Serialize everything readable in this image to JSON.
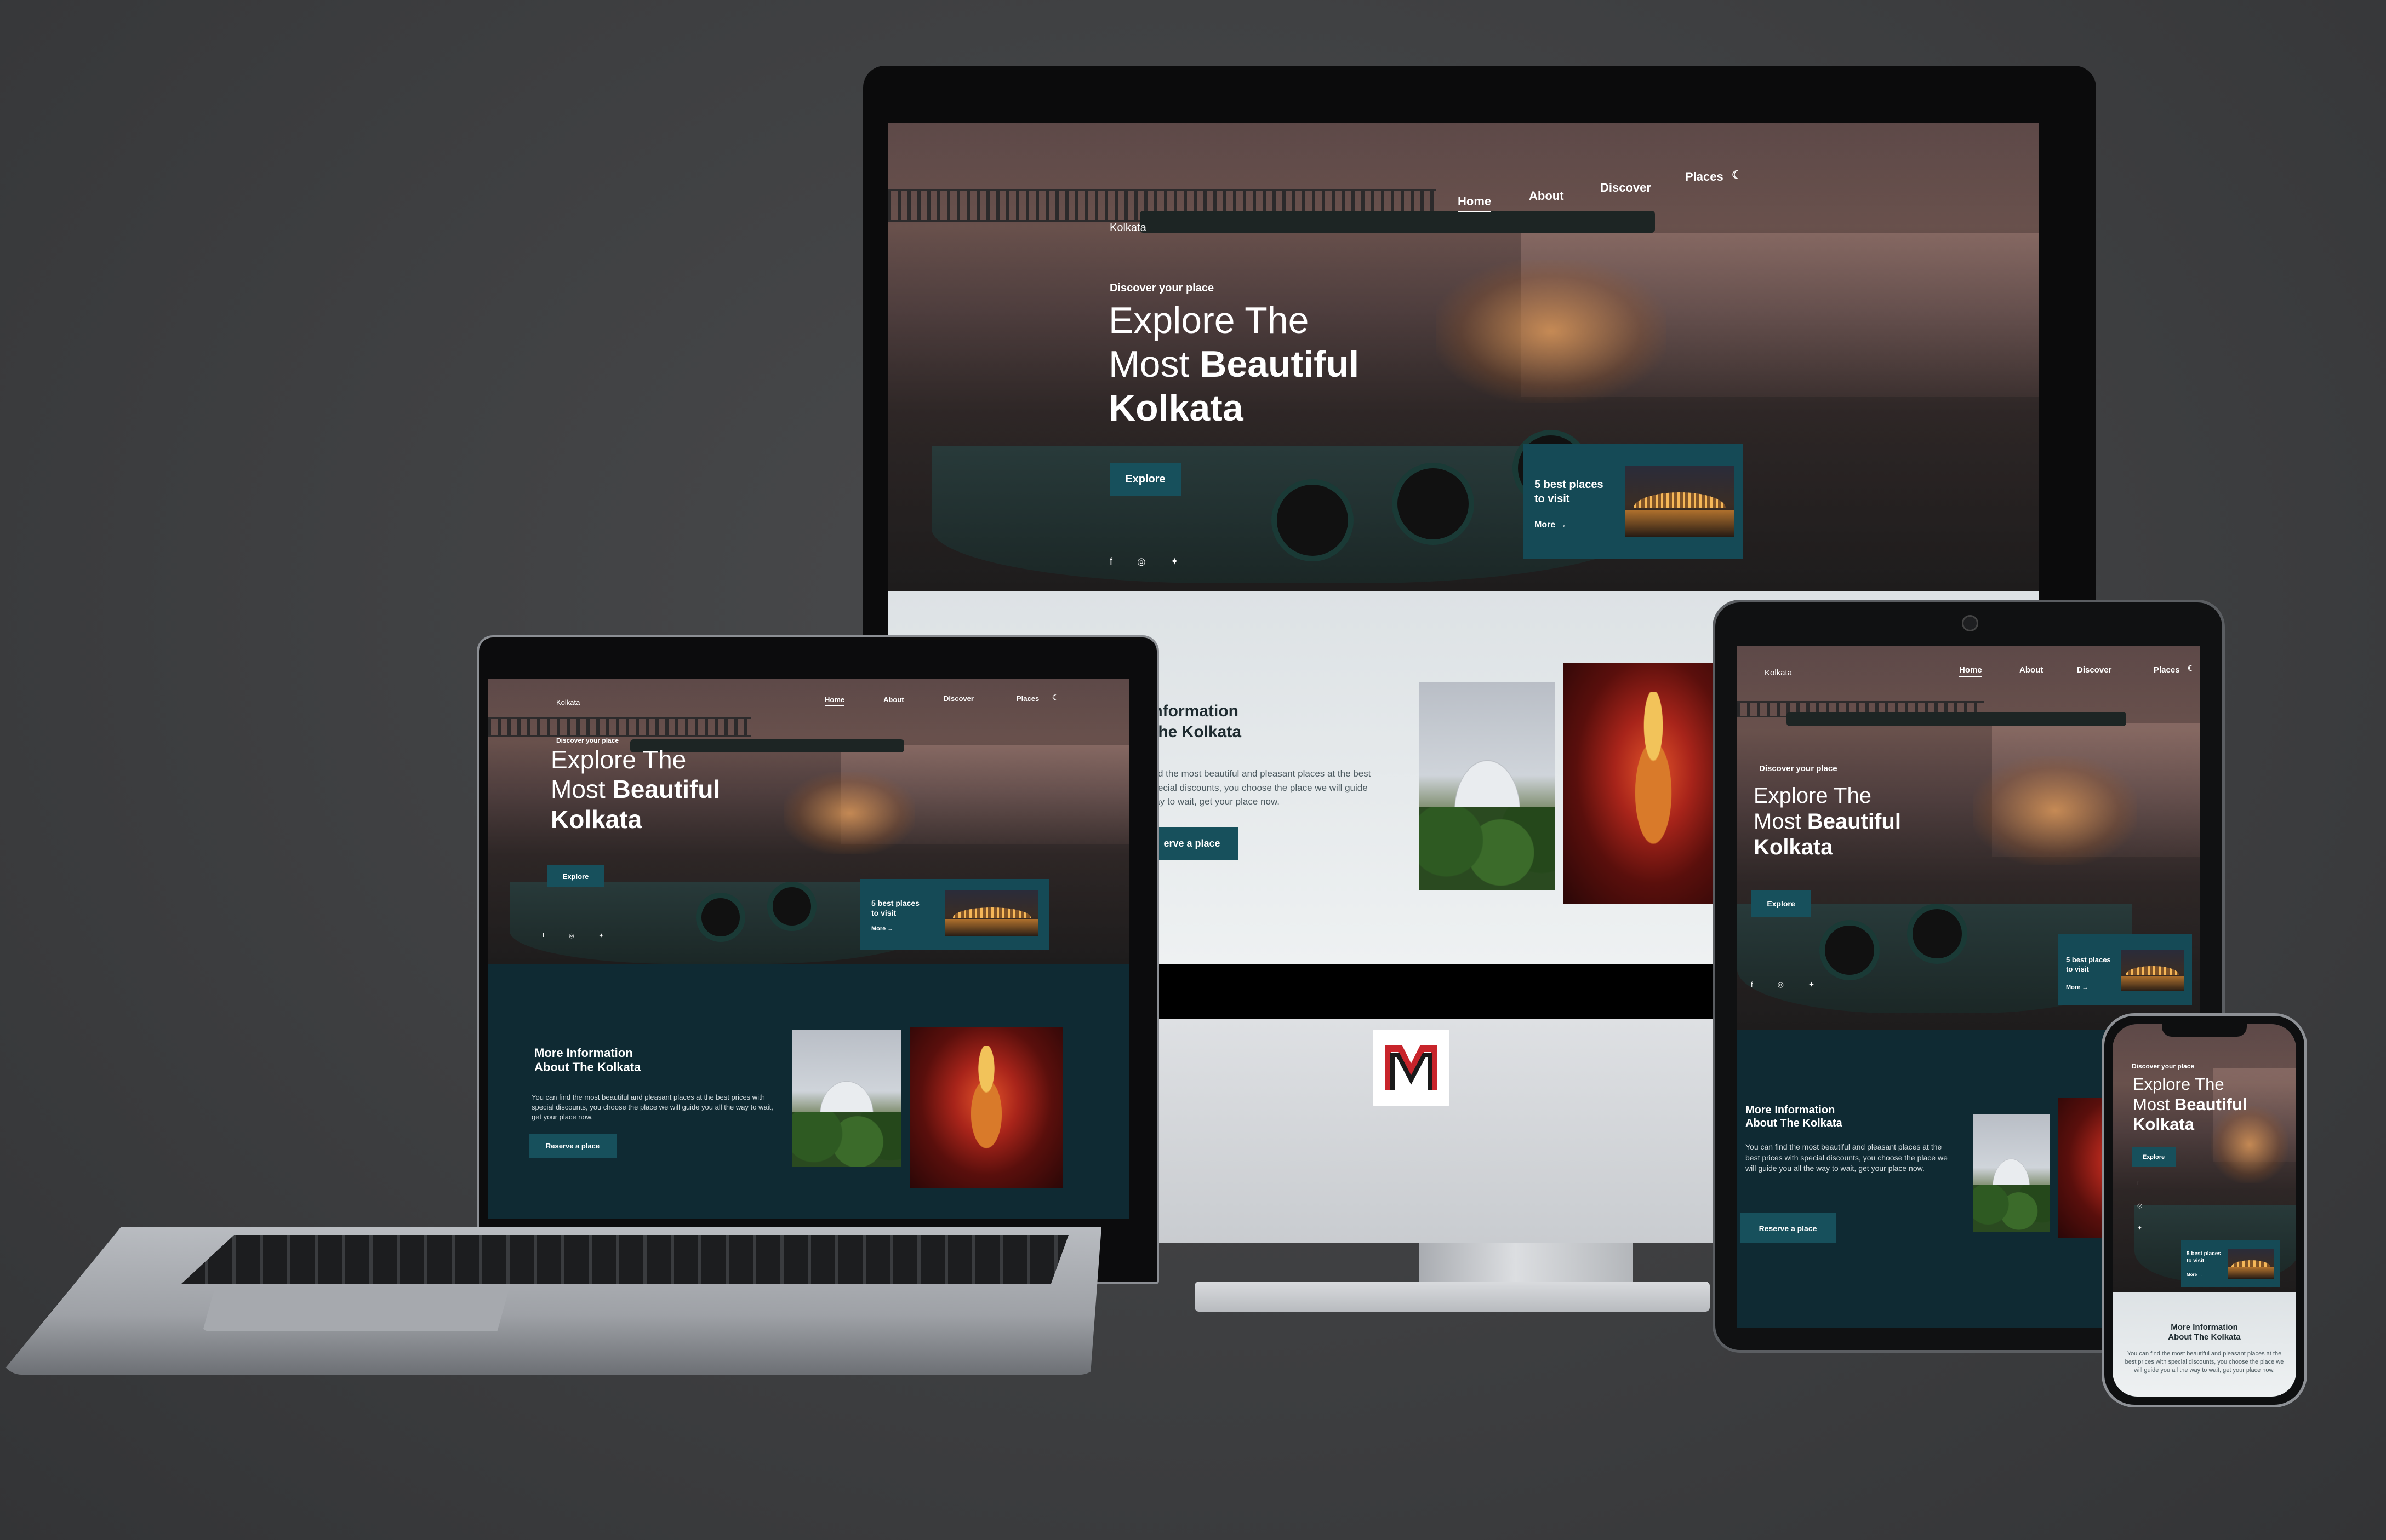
{
  "site": {
    "logo": "Kolkata",
    "nav": {
      "home": "Home",
      "about": "About",
      "discover": "Discover",
      "places": "Places"
    },
    "theme_icon": "moon-icon",
    "hero_subtitle": "Discover your place",
    "hero_title_line1": "Explore The",
    "hero_title_line2_light": "Most",
    "hero_title_line2_bold": "Beautiful",
    "hero_title_line3": "Kolkata",
    "explore_button": "Explore",
    "social": [
      "facebook-icon",
      "instagram-icon",
      "twitter-icon"
    ],
    "card_title_line1": "5 best places",
    "card_title_line2": "to visit",
    "card_more": "More",
    "info_title_line1": "More Information",
    "info_title_line2": "About The Kolkata",
    "info_body": "You can find the most beautiful and pleasant places at the best prices with special discounts, you choose the place we will guide you all the way to wait, get your place now.",
    "desktop_info_title_line1": "Information",
    "desktop_info_title_line2": "The Kolkata",
    "desktop_info_body_line1": "find the most beautiful and pleasant places at the best",
    "desktop_info_body_line2": "special discounts, you choose the place we will guide",
    "desktop_info_body_line3": "way to wait, get your place now.",
    "desktop_reserve": "erve a place",
    "reserve_button": "Reserve a place"
  },
  "colors": {
    "accent": "#17505c",
    "dark_bg": "#0f2a33",
    "card_bg": "#154a56",
    "backdrop": "#3e3f41"
  }
}
